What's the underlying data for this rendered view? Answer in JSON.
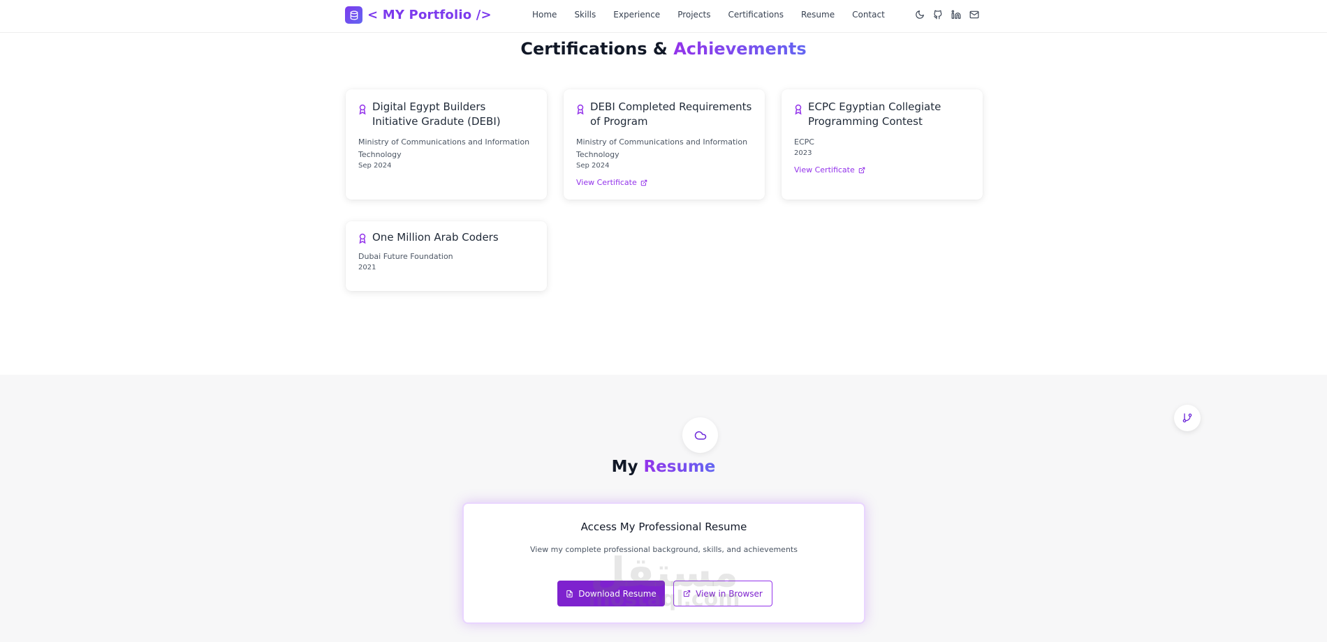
{
  "header": {
    "logo_text": "< MY Portfolio />",
    "nav": [
      "Home",
      "Skills",
      "Experience",
      "Projects",
      "Certifications",
      "Resume",
      "Contact"
    ],
    "icons": [
      "moon-icon",
      "github-icon",
      "linkedin-icon",
      "mail-icon"
    ]
  },
  "certifications": {
    "title_main": "Certifications &",
    "title_accent": "Achievements",
    "cards": [
      {
        "title": "Digital Egypt Builders Initiative Gradute (DEBI)",
        "issuer": "Ministry of Communications and Information Technology",
        "date": "Sep 2024",
        "link": ""
      },
      {
        "title": "DEBI Completed Requirements of Program",
        "issuer": "Ministry of Communications and Information Technology",
        "date": "Sep 2024",
        "link": "View Certificate"
      },
      {
        "title": "ECPC Egyptian Collegiate Programming Contest",
        "issuer": "ECPC",
        "date": "2023",
        "link": "View Certificate"
      },
      {
        "title": "One Million Arab Coders",
        "issuer": "Dubai Future Foundation",
        "date": "2021",
        "link": ""
      }
    ]
  },
  "resume": {
    "title_main": "My",
    "title_accent": "Resume",
    "card_heading": "Access My Professional Resume",
    "card_desc": "View my complete professional background, skills, and achievements",
    "download_label": "Download Resume",
    "view_label": "View in Browser"
  },
  "watermark": {
    "arabic": "مستقل",
    "latin": "mostaql.com"
  },
  "colors": {
    "accent": "#9333ea",
    "accent_gradient_end": "#6366f1",
    "button_primary": "#7e22ce",
    "section_bg": "#f7f7f8"
  }
}
